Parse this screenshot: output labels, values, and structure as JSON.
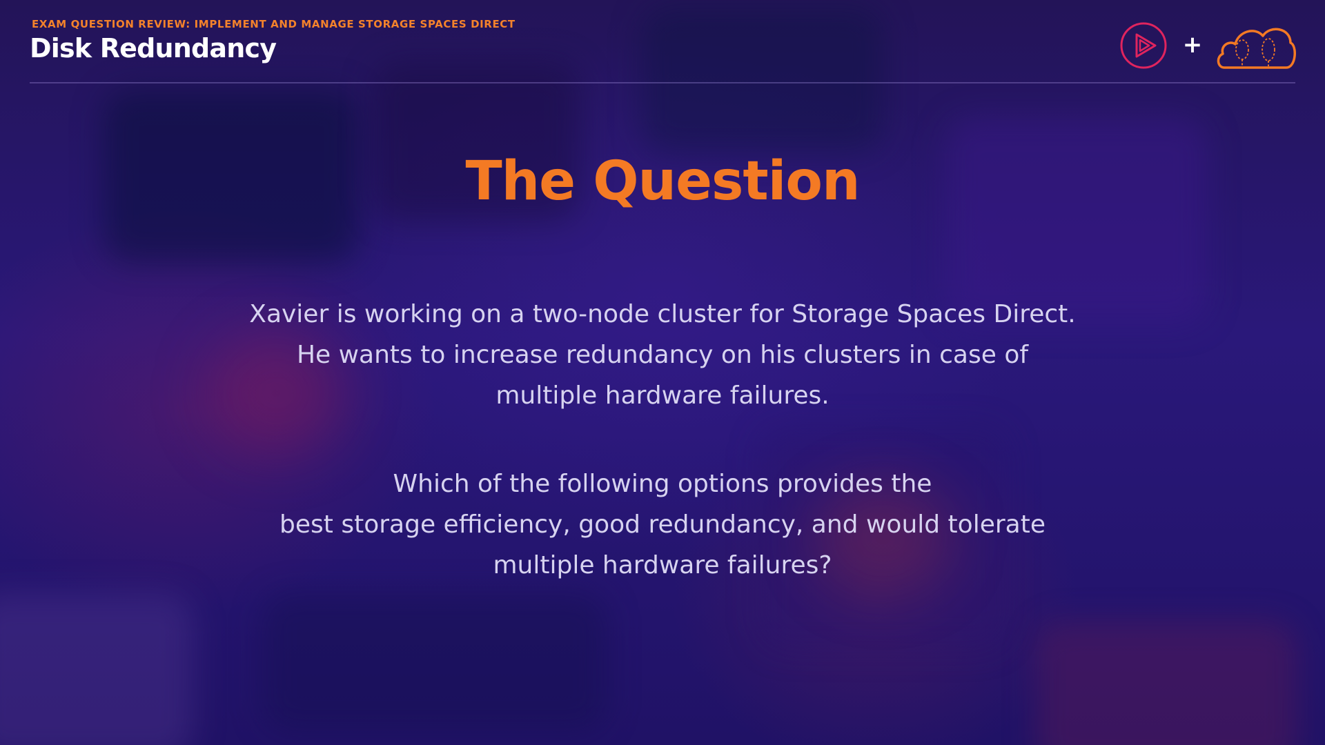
{
  "header": {
    "subtitle": "EXAM QUESTION REVIEW: IMPLEMENT AND MANAGE STORAGE SPACES DIRECT",
    "title": "Disk Redundancy",
    "plus_symbol": "+",
    "logos": [
      "play-logo-icon",
      "cloud-logo-icon"
    ]
  },
  "main": {
    "heading": "The Question",
    "paragraph1": [
      "Xavier is working on a two-node cluster for Storage Spaces Direct.",
      "He wants to increase redundancy on his clusters in case of",
      "multiple hardware failures."
    ],
    "paragraph2": [
      "Which of the following options provides the",
      "best storage efficiency, good redundancy, and would tolerate",
      "multiple hardware failures?"
    ]
  },
  "colors": {
    "accent_orange": "#f47a24",
    "play_logo_red": "#e0245e",
    "background": "#241664",
    "body_text": "#d7d3f0"
  }
}
